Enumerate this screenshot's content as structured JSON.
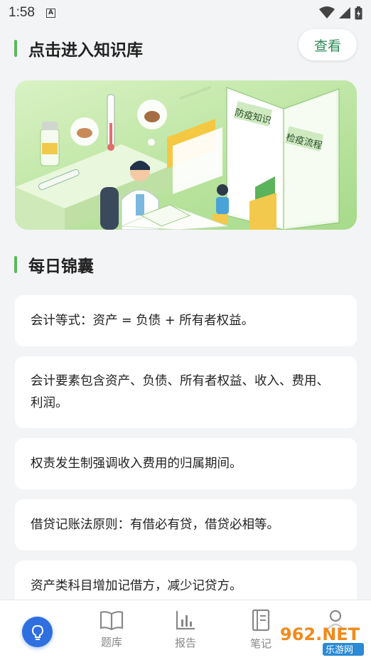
{
  "status_bar": {
    "time": "1:58"
  },
  "header": {
    "title": "点击进入知识库",
    "view_button": "查看"
  },
  "banner": {
    "book_left_label": "防疫知识",
    "book_right_label": "检疫流程"
  },
  "tips_section": {
    "title": "每日锦囊",
    "items": [
      "会计等式：资产 = 负债 + 所有者权益。",
      "会计要素包含资产、负债、所有者权益、收入、费用、利润。",
      "权责发生制强调收入费用的归属期间。",
      "借贷记账法原则：有借必有贷，借贷必相等。",
      "资产类科目增加记借方，减少记贷方。"
    ]
  },
  "bottom_nav": {
    "items": [
      {
        "label": "题库",
        "icon": "book-icon"
      },
      {
        "label": "报告",
        "icon": "bar-chart-icon"
      },
      {
        "label": "笔记",
        "icon": "notebook-icon"
      }
    ],
    "fab_icon": "lightbulb-icon"
  },
  "watermark": {
    "brand": "962.NET",
    "sub": "乐游网"
  },
  "colors": {
    "accent_green": "#5cb85c",
    "fab_blue": "#2f6fe0"
  }
}
